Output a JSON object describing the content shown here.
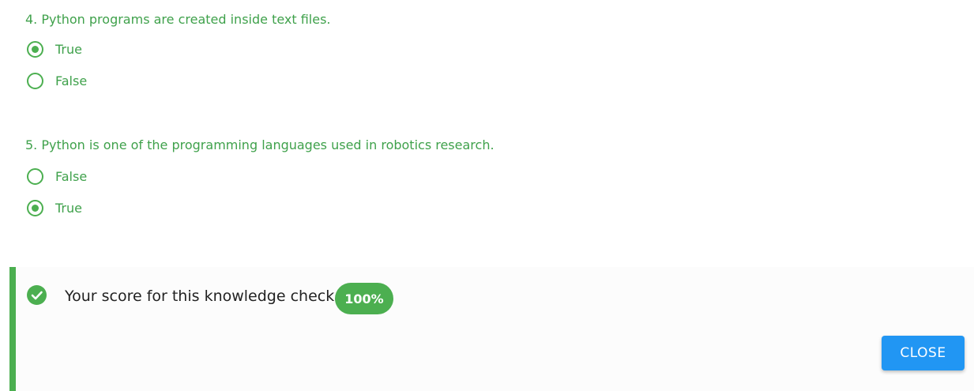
{
  "questions": [
    {
      "text": "4. Python programs are created inside text files.",
      "options": [
        {
          "label": "True",
          "selected": true
        },
        {
          "label": "False",
          "selected": false
        }
      ]
    },
    {
      "text": "5. Python is one of the programming languages used in robotics research.",
      "options": [
        {
          "label": "False",
          "selected": false
        },
        {
          "label": "True",
          "selected": true
        }
      ]
    }
  ],
  "result": {
    "message": "Your score for this knowledge check:",
    "score": "100%",
    "icon": "check-circle-icon"
  },
  "actions": {
    "close_label": "CLOSE"
  },
  "colors": {
    "accent_green": "#4caf50",
    "question_text": "#3fa14b",
    "close_button": "#2196f3"
  }
}
